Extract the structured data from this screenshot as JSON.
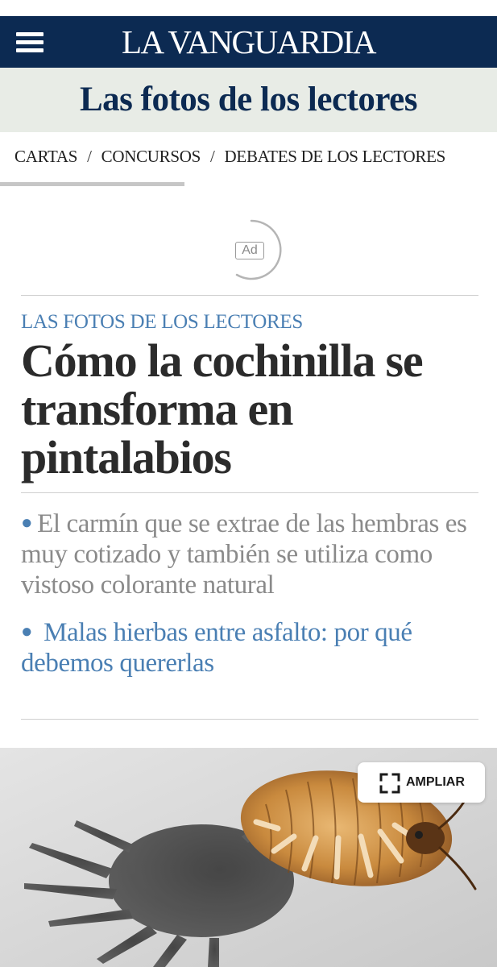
{
  "header": {
    "logo": "LA VANGUARDIA",
    "section_title": "Las fotos de los lectores"
  },
  "subnav": {
    "items": [
      {
        "label": "CARTAS"
      },
      {
        "label": "CONCURSOS"
      },
      {
        "label": "DEBATES DE LOS LECTORES"
      }
    ],
    "separator": "/"
  },
  "ad": {
    "label": "Ad"
  },
  "article": {
    "kicker": "LAS FOTOS DE LOS LECTORES",
    "headline": "Cómo la cochinilla se transforma en pintalabios",
    "bullets": [
      {
        "text": "El carmín que se extrae de las hembras es muy cotizado y también se utiliza como vistoso colorante natural",
        "link": false
      },
      {
        "text": "Malas hierbas entre asfalto: por qué debemos quererlas",
        "link": true
      }
    ]
  },
  "photo": {
    "zoom_label": "AMPLIAR"
  },
  "icons": {
    "menu": "hamburger-menu-icon",
    "zoom": "expand-corners-icon",
    "ad_loader": "loading-ring-icon"
  },
  "colors": {
    "brand_navy": "#0c2a52",
    "banner_bg": "#e8ece6",
    "accent_blue": "#4a7fb3",
    "headline_text": "#2b2b2b",
    "summary_text": "#8a8a8a"
  }
}
